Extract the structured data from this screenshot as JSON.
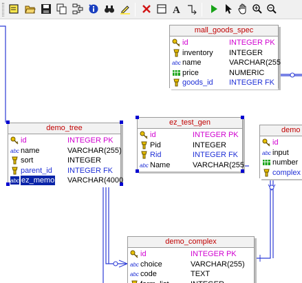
{
  "toolbar": {
    "buttons": [
      "new-icon",
      "open-icon",
      "save-icon",
      "copy-icon",
      "layout-icon",
      "info-icon",
      "binoculars-icon",
      "highlighter-icon",
      "delete-icon",
      "table-icon",
      "text-icon",
      "connector-icon",
      "run-icon",
      "pointer-icon",
      "hand-icon",
      "zoom-in-icon",
      "zoom-out-icon"
    ]
  },
  "colors": {
    "header_text": "#c00000",
    "pk": "#d000d0",
    "fk": "#1f2fd6",
    "relation": "#2b3ad6",
    "selection": "#0a24a8"
  },
  "tables": {
    "mall_goods_spec": {
      "title": "mall_goods_spec",
      "fields": [
        {
          "icon": "key-icon",
          "name": "id",
          "type": "INTEGER PK",
          "kind": "pk"
        },
        {
          "icon": "not-null-icon",
          "name": "inventory",
          "type": "INTEGER",
          "kind": "plain"
        },
        {
          "icon": "text-field-icon",
          "name": "name",
          "type": "VARCHAR(255",
          "kind": "plain"
        },
        {
          "icon": "numeric-icon",
          "name": "price",
          "type": "NUMERIC",
          "kind": "plain"
        },
        {
          "icon": "not-null-icon",
          "name": "goods_id",
          "type": "INTEGER FK",
          "kind": "fk"
        }
      ]
    },
    "demo_tree": {
      "title": "demo_tree",
      "fields": [
        {
          "icon": "key-icon",
          "name": "id",
          "type": "INTEGER PK",
          "kind": "pk"
        },
        {
          "icon": "text-field-icon",
          "name": "name",
          "type": "VARCHAR(255)",
          "kind": "plain"
        },
        {
          "icon": "not-null-icon",
          "name": "sort",
          "type": "INTEGER",
          "kind": "plain"
        },
        {
          "icon": "not-null-icon",
          "name": "parent_id",
          "type": "INTEGER FK",
          "kind": "fk"
        },
        {
          "icon": "text-field-icon",
          "name": "ez_memo",
          "type": "VARCHAR(4000",
          "kind": "plain",
          "selected": true
        }
      ]
    },
    "ez_test_gen": {
      "title": "ez_test_gen",
      "fields": [
        {
          "icon": "key-icon",
          "name": "id",
          "type": "INTEGER PK",
          "kind": "pk"
        },
        {
          "icon": "not-null-icon",
          "name": "Pid",
          "type": "INTEGER",
          "kind": "plain"
        },
        {
          "icon": "not-null-icon",
          "name": "Rid",
          "type": "INTEGER FK",
          "kind": "fk"
        },
        {
          "icon": "text-field-icon",
          "name": "Name",
          "type": "VARCHAR(255",
          "kind": "plain"
        }
      ]
    },
    "demo_partial": {
      "title": "demo",
      "fields": [
        {
          "icon": "key-icon",
          "name": "id",
          "type": "",
          "kind": "pk"
        },
        {
          "icon": "text-field-icon",
          "name": "input",
          "type": "",
          "kind": "plain"
        },
        {
          "icon": "numeric-icon",
          "name": "number",
          "type": "",
          "kind": "plain"
        },
        {
          "icon": "not-null-icon",
          "name": "complex",
          "type": "",
          "kind": "fk"
        }
      ]
    },
    "demo_complex": {
      "title": "demo_complex",
      "fields": [
        {
          "icon": "key-icon",
          "name": "id",
          "type": "INTEGER PK",
          "kind": "pk"
        },
        {
          "icon": "text-field-icon",
          "name": "choice",
          "type": "VARCHAR(255)",
          "kind": "plain"
        },
        {
          "icon": "text-field-icon",
          "name": "code",
          "type": "TEXT",
          "kind": "plain"
        },
        {
          "icon": "not-null-icon",
          "name": "form_list",
          "type": "INTEGER",
          "kind": "plain"
        }
      ]
    }
  }
}
